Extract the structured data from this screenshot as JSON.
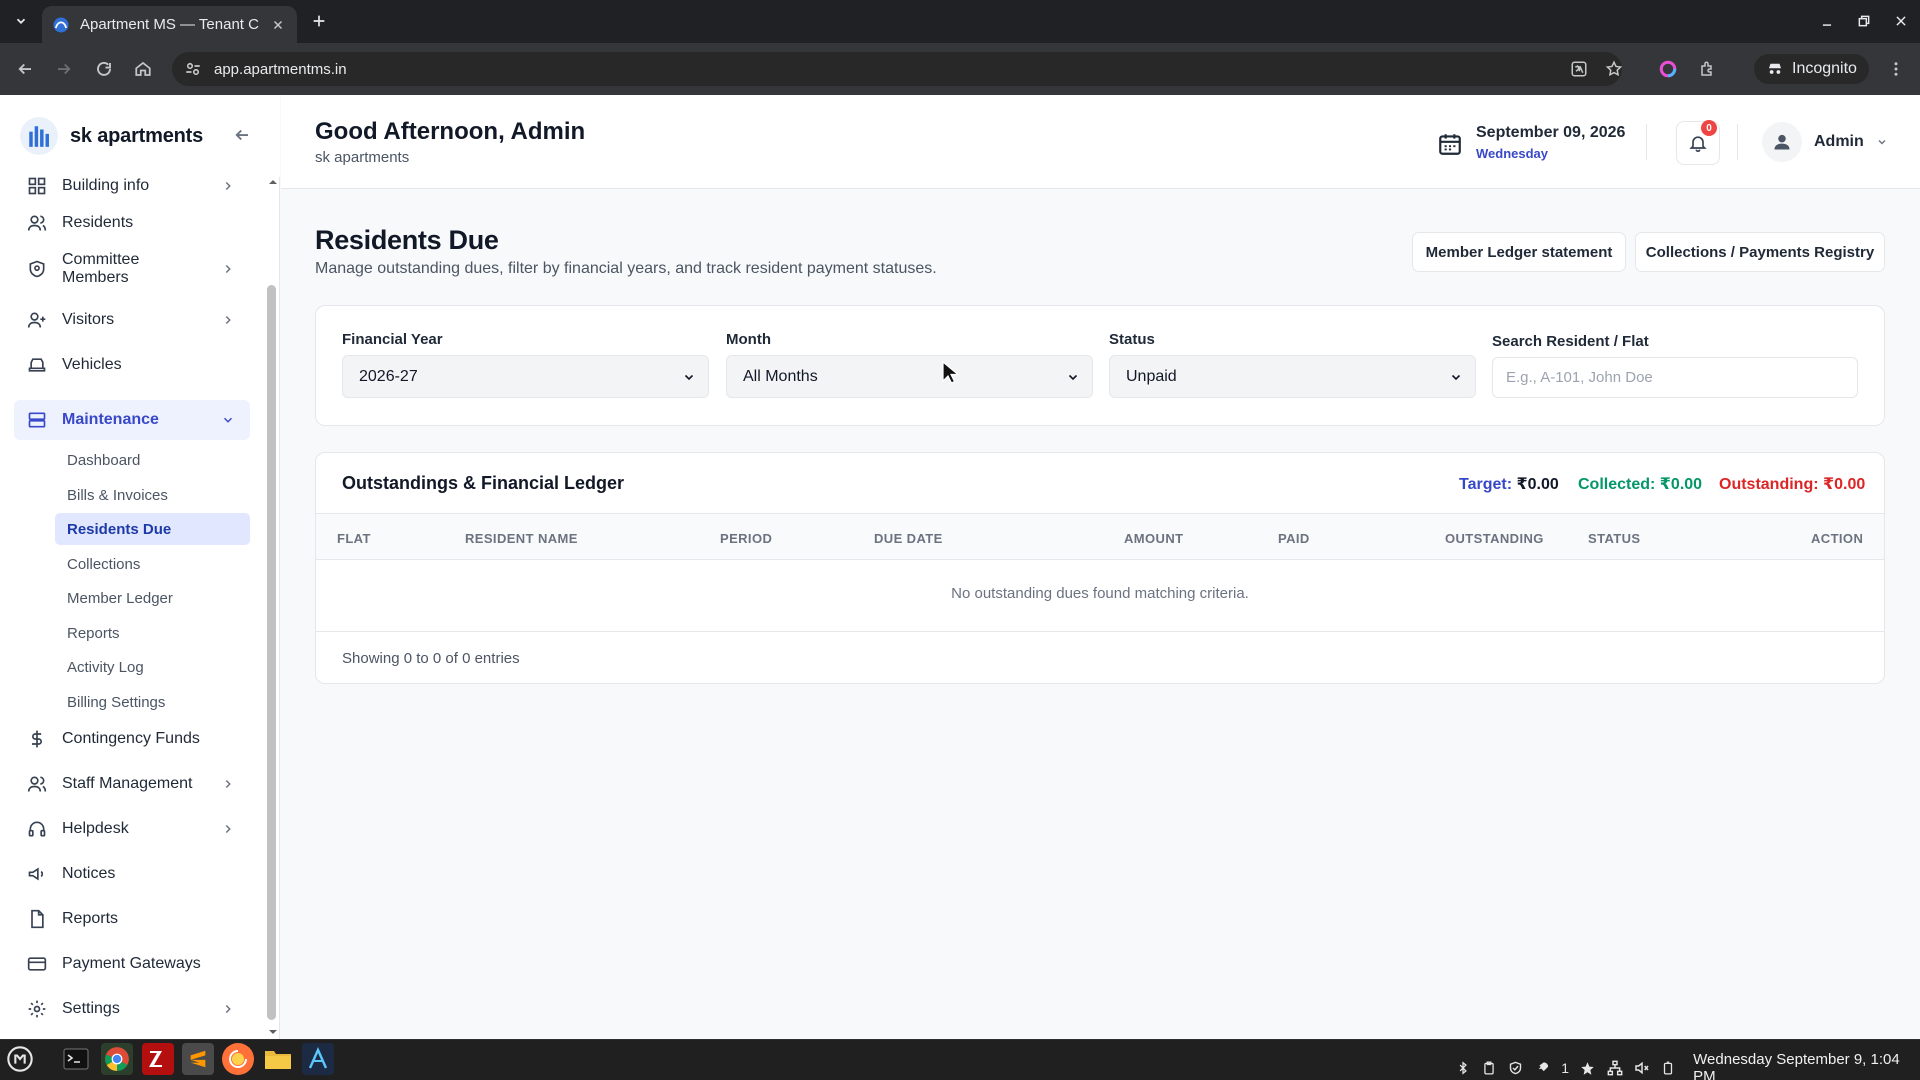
{
  "browser": {
    "tab_title": "Apartment MS — Tenant Cor",
    "url": "app.apartmentms.in",
    "profile": "Incognito"
  },
  "brand": {
    "name": "sk apartments"
  },
  "sidebar": {
    "items": [
      {
        "label": "Building info",
        "icon": "grid-icon",
        "chevron": true
      },
      {
        "label": "Residents",
        "icon": "users-icon",
        "chevron": false
      },
      {
        "label": "Committee Members",
        "icon": "shield-icon",
        "chevron": true
      },
      {
        "label": "Visitors",
        "icon": "user-plus-icon",
        "chevron": true
      },
      {
        "label": "Vehicles",
        "icon": "car-icon",
        "chevron": false
      },
      {
        "label": "Maintenance",
        "icon": "server-icon",
        "chevron": true
      },
      {
        "label": "Contingency Funds",
        "icon": "dollar-icon",
        "chevron": false
      },
      {
        "label": "Staff Management",
        "icon": "users-icon",
        "chevron": true
      },
      {
        "label": "Helpdesk",
        "icon": "headphones-icon",
        "chevron": true
      },
      {
        "label": "Notices",
        "icon": "megaphone-icon",
        "chevron": false
      },
      {
        "label": "Reports",
        "icon": "file-icon",
        "chevron": false
      },
      {
        "label": "Payment Gateways",
        "icon": "credit-card-icon",
        "chevron": false
      },
      {
        "label": "Settings",
        "icon": "gear-icon",
        "chevron": true
      }
    ],
    "maintenance_sub": [
      "Dashboard",
      "Bills & Invoices",
      "Residents Due",
      "Collections",
      "Member Ledger",
      "Reports",
      "Activity Log",
      "Billing Settings"
    ]
  },
  "header": {
    "greeting": "Good Afternoon, Admin",
    "subtitle": "sk apartments",
    "date": "September 09, 2026",
    "weekday": "Wednesday",
    "notification_count": "0",
    "user": "Admin"
  },
  "page": {
    "title": "Residents Due",
    "description": "Manage outstanding dues, filter by financial years, and track resident payment statuses.",
    "btn_ledger": "Member Ledger statement",
    "btn_registry": "Collections / Payments Registry"
  },
  "filters": {
    "financial_year_label": "Financial Year",
    "financial_year_value": "2026-27",
    "month_label": "Month",
    "month_value": "All Months",
    "status_label": "Status",
    "status_value": "Unpaid",
    "search_label": "Search Resident / Flat",
    "search_placeholder": "E.g., A-101, John Doe"
  },
  "ledger": {
    "title": "Outstandings & Financial Ledger",
    "target_label": "Target:",
    "target_value": "₹0.00",
    "collected_label": "Collected:",
    "collected_value": "₹0.00",
    "outstanding_label": "Outstanding:",
    "outstanding_value": "₹0.00",
    "columns": [
      "FLAT",
      "RESIDENT NAME",
      "PERIOD",
      "DUE DATE",
      "AMOUNT",
      "PAID",
      "OUTSTANDING",
      "STATUS",
      "ACTION"
    ],
    "empty_message": "No outstanding dues found matching criteria.",
    "showing": "Showing 0 to 0 of 0 entries"
  },
  "taskbar": {
    "clock": "Wednesday September 9, 1:04 PM",
    "tray_count": "1"
  },
  "colors": {
    "accent": "#3848c8",
    "collected": "#059669",
    "outstanding": "#dc2626",
    "badge": "#ef4444"
  }
}
